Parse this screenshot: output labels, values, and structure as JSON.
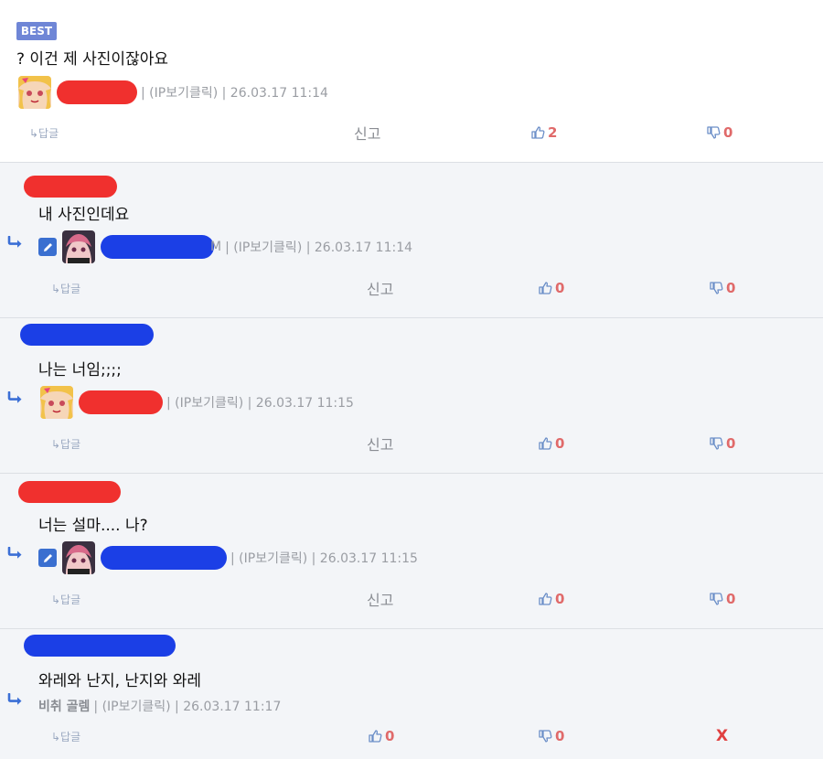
{
  "comments": [
    {
      "badge": "BEST",
      "content": "? 이건 제 사진이잖아요",
      "meta": "| (IP보기클릭) | 26.03.17 11:14",
      "reply_label": "↳답글",
      "report_label": "신고",
      "up_count": "2",
      "down_count": "0"
    },
    {
      "content": "내 사진인데요",
      "name_tail": "M",
      "meta": "| (IP보기클릭) | 26.03.17 11:14",
      "reply_label": "↳답글",
      "report_label": "신고",
      "up_count": "0",
      "down_count": "0"
    },
    {
      "content": "나는 너임;;;;",
      "meta": "| (IP보기클릭) | 26.03.17 11:15",
      "reply_label": "↳답글",
      "report_label": "신고",
      "up_count": "0",
      "down_count": "0"
    },
    {
      "content": "너는 설마.... 나?",
      "meta": "| (IP보기클릭) | 26.03.17 11:15",
      "reply_label": "↳답글",
      "report_label": "신고",
      "up_count": "0",
      "down_count": "0"
    },
    {
      "content": "와레와 난지, 난지와 와레",
      "author": "비취 골렘",
      "meta": "| (IP보기클릭) | 26.03.17 11:17",
      "reply_label": "↳답글",
      "up_count": "0",
      "down_count": "0",
      "delete_label": "X"
    }
  ],
  "colors": {
    "redaction_red": "#f0302e",
    "redaction_blue": "#1b3fe6",
    "best_badge": "#6f86d6",
    "reply_bg": "#f3f5f8",
    "vote_count": "#e06a6a"
  },
  "icons": {
    "reply_arrow": "reply-arrow-icon",
    "thumbs_up": "thumbs-up-icon",
    "thumbs_down": "thumbs-down-icon",
    "edit": "pencil-icon"
  }
}
